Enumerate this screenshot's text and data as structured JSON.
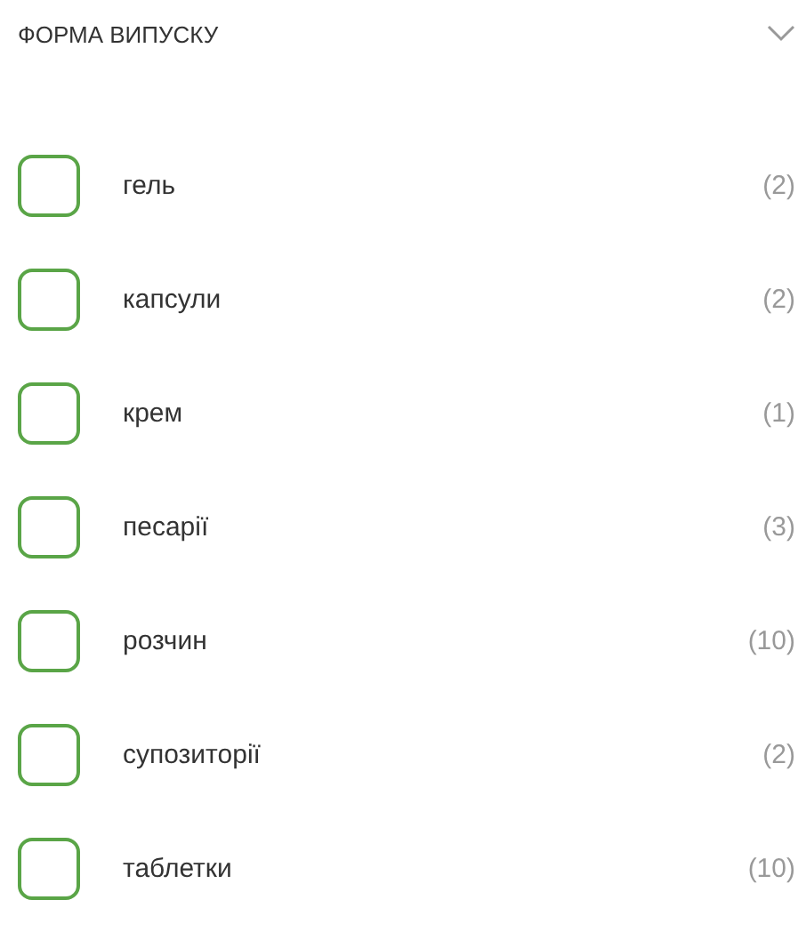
{
  "filter": {
    "title": "ФОРМА ВИПУСКУ",
    "expanded": true,
    "options": [
      {
        "label": "гель",
        "count": "(2)",
        "checked": false
      },
      {
        "label": "капсули",
        "count": "(2)",
        "checked": false
      },
      {
        "label": "крем",
        "count": "(1)",
        "checked": false
      },
      {
        "label": "песарії",
        "count": "(3)",
        "checked": false
      },
      {
        "label": "розчин",
        "count": "(10)",
        "checked": false
      },
      {
        "label": "супозиторії",
        "count": "(2)",
        "checked": false
      },
      {
        "label": "таблетки",
        "count": "(10)",
        "checked": false
      }
    ]
  }
}
